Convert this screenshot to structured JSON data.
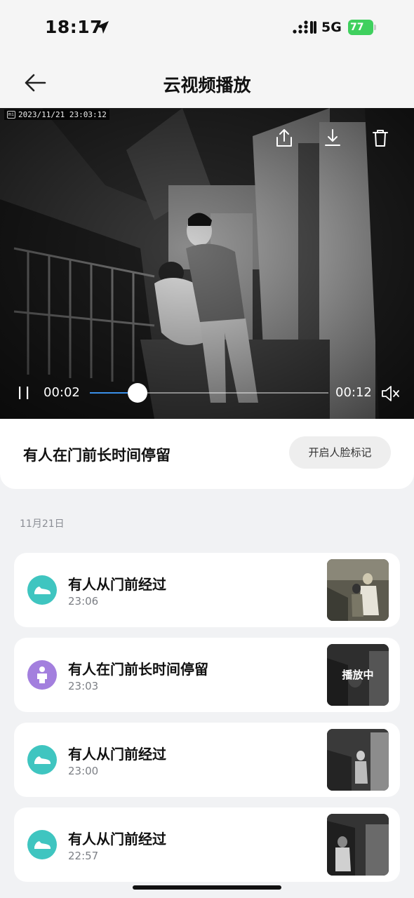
{
  "status_bar": {
    "time": "18:17",
    "network": "5G",
    "battery": "77",
    "icons": [
      "location-arrow-icon",
      "signal-icon",
      "battery-icon"
    ]
  },
  "nav": {
    "title": "云视频播放",
    "back_icon": "back-arrow-icon"
  },
  "video": {
    "timestamp": "2023/11/21  23:03:12",
    "camera_logo": "mi",
    "actions": [
      "share-icon",
      "download-icon",
      "delete-icon"
    ],
    "current_time": "00:02",
    "total_time": "00:12",
    "progress": 0.2,
    "muted": true,
    "playing": true
  },
  "event": {
    "title": "有人在门前长时间停留",
    "face_button": "开启人脸标记"
  },
  "list": {
    "date": "11月21日",
    "items": [
      {
        "title": "有人从门前经过",
        "time": "23:06",
        "icon": "shoe-icon",
        "icon_color": "#3fc5c0",
        "thumb_label": ""
      },
      {
        "title": "有人在门前长时间停留",
        "time": "23:03",
        "icon": "person-icon",
        "icon_color": "#a37fde",
        "thumb_label": "播放中"
      },
      {
        "title": "有人从门前经过",
        "time": "23:00",
        "icon": "shoe-icon",
        "icon_color": "#3fc5c0",
        "thumb_label": ""
      },
      {
        "title": "有人从门前经过",
        "time": "22:57",
        "icon": "shoe-icon",
        "icon_color": "#3fc5c0",
        "thumb_label": ""
      }
    ]
  },
  "colors": {
    "accent": "#3a8fe8",
    "battery": "#3fd05e",
    "page_bg": "#f1f2f4"
  }
}
